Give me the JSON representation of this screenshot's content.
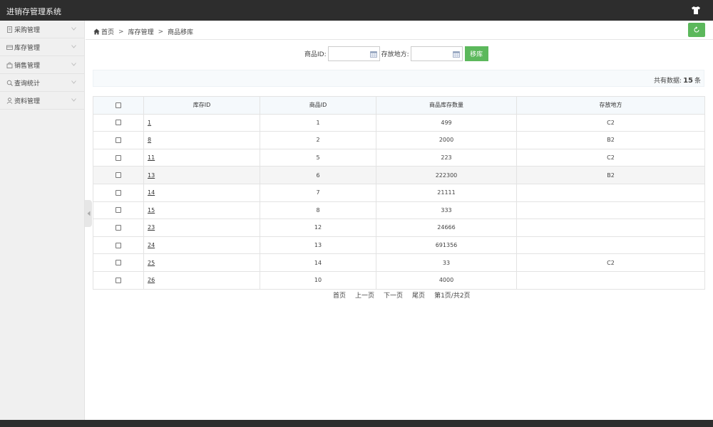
{
  "app": {
    "title": "进销存管理系统",
    "icon": "shirt-icon"
  },
  "sidebar": {
    "items": [
      {
        "label": "采购管理",
        "icon": "document-icon"
      },
      {
        "label": "库存管理",
        "icon": "card-icon"
      },
      {
        "label": "销售管理",
        "icon": "bag-icon"
      },
      {
        "label": "查询统计",
        "icon": "search-icon"
      },
      {
        "label": "资料管理",
        "icon": "user-icon"
      }
    ]
  },
  "breadcrumb": {
    "home": "首页",
    "section": "库存管理",
    "current": "商品移库",
    "separator": ">"
  },
  "search": {
    "product_label": "商品ID:",
    "product_value": "",
    "location_label": "存放地方:",
    "location_value": "",
    "button": "移库"
  },
  "summary": {
    "prefix": "共有数据:",
    "count": "15",
    "suffix": "条"
  },
  "table": {
    "headers": [
      "库存ID",
      "商品ID",
      "商品库存数量",
      "存放地方"
    ],
    "rows": [
      {
        "stock_id": "1",
        "product_id": "1",
        "qty": "499",
        "location": "C2"
      },
      {
        "stock_id": "8",
        "product_id": "2",
        "qty": "2000",
        "location": "B2"
      },
      {
        "stock_id": "11",
        "product_id": "5",
        "qty": "223",
        "location": "C2"
      },
      {
        "stock_id": "13",
        "product_id": "6",
        "qty": "222300",
        "location": "B2"
      },
      {
        "stock_id": "14",
        "product_id": "7",
        "qty": "21111",
        "location": ""
      },
      {
        "stock_id": "15",
        "product_id": "8",
        "qty": "333",
        "location": ""
      },
      {
        "stock_id": "23",
        "product_id": "12",
        "qty": "24666",
        "location": ""
      },
      {
        "stock_id": "24",
        "product_id": "13",
        "qty": "691356",
        "location": ""
      },
      {
        "stock_id": "25",
        "product_id": "14",
        "qty": "33",
        "location": "C2"
      },
      {
        "stock_id": "26",
        "product_id": "10",
        "qty": "4000",
        "location": ""
      }
    ]
  },
  "pager": {
    "first": "首页",
    "prev": "上一页",
    "next": "下一页",
    "last": "尾页",
    "status": "第1页/共2页"
  },
  "colors": {
    "topbar": "#2d2d2d",
    "accent_green": "#5cb85c",
    "sidebar_bg": "#f0f0f0"
  }
}
